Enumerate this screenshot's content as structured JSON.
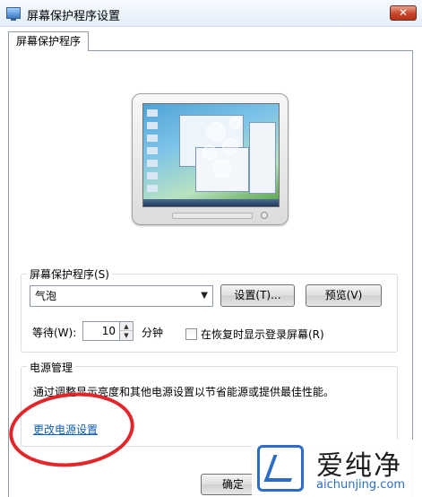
{
  "window": {
    "title": "屏幕保护程序设置",
    "close_label": "✕"
  },
  "tabs": [
    {
      "label": "屏幕保护程序"
    }
  ],
  "screensaver": {
    "group_label": "屏幕保护程序(S)",
    "selected": "气泡",
    "settings_button": "设置(T)...",
    "preview_button": "预览(V)",
    "wait_label": "等待(W):",
    "wait_value": "10",
    "minutes_label": "分钟",
    "resume_checkbox_label": "在恢复时显示登录屏幕(R)",
    "resume_checked": false
  },
  "power": {
    "group_label": "电源管理",
    "description": "通过调整显示亮度和其他电源设置以节省能源或提供最佳性能。",
    "link": "更改电源设置"
  },
  "footer": {
    "ok_button": "确定"
  },
  "watermark": {
    "text_cn": "爱纯净",
    "text_en": "aichunjing.com"
  },
  "annotation_color": "#e3262a",
  "link_color": "#0f5fb4"
}
